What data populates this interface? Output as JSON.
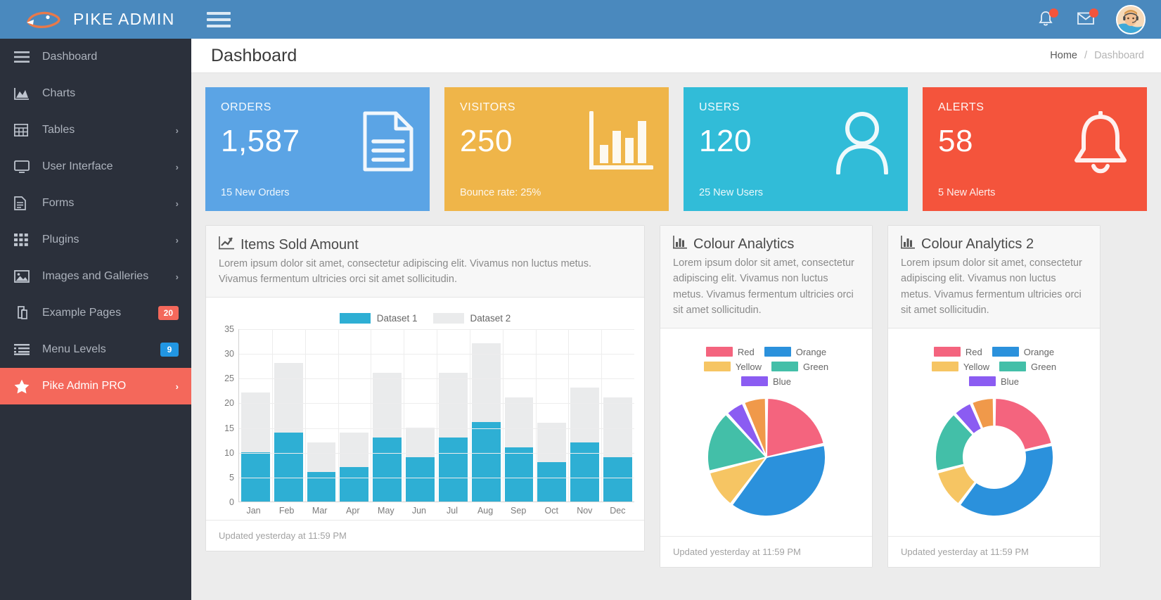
{
  "brand": {
    "title": "PIKE ADMIN",
    "logo_icon": "fish-logo-icon",
    "bg": "#4A89BE"
  },
  "sidebar": {
    "bg": "#2B303B",
    "active_color": "#F4685B",
    "items": [
      {
        "label": "Dashboard",
        "icon": "menu-bars-icon",
        "caret": "",
        "badge": "",
        "badge_type": "",
        "active": false
      },
      {
        "label": "Charts",
        "icon": "area-chart-icon",
        "caret": "",
        "badge": "",
        "badge_type": "",
        "active": false
      },
      {
        "label": "Tables",
        "icon": "table-grid-icon",
        "caret": "›",
        "badge": "",
        "badge_type": "",
        "active": false
      },
      {
        "label": "User Interface",
        "icon": "monitor-icon",
        "caret": "›",
        "badge": "",
        "badge_type": "",
        "active": false
      },
      {
        "label": "Forms",
        "icon": "document-lines-icon",
        "caret": "›",
        "badge": "",
        "badge_type": "",
        "active": false
      },
      {
        "label": "Plugins",
        "icon": "grid-dots-icon",
        "caret": "›",
        "badge": "",
        "badge_type": "",
        "active": false
      },
      {
        "label": "Images and Galleries",
        "icon": "image-picture-icon",
        "caret": "›",
        "badge": "",
        "badge_type": "",
        "active": false
      },
      {
        "label": "Example Pages",
        "icon": "copy-pages-icon",
        "caret": "",
        "badge": "20",
        "badge_type": "red",
        "active": false
      },
      {
        "label": "Menu Levels",
        "icon": "list-indent-icon",
        "caret": "",
        "badge": "9",
        "badge_type": "blue",
        "active": false
      },
      {
        "label": "Pike Admin PRO",
        "icon": "star-icon",
        "caret": "›",
        "badge": "",
        "badge_type": "",
        "active": true
      }
    ]
  },
  "topbar": {
    "menu_toggle_icon": "hamburger-icon",
    "notifications_icon": "bell-icon",
    "messages_icon": "envelope-icon",
    "avatar_icon": "user-avatar",
    "notification_badge": true,
    "message_badge": true
  },
  "page": {
    "title": "Dashboard",
    "breadcrumb": {
      "home": "Home",
      "separator": "/",
      "current": "Dashboard"
    }
  },
  "stats": [
    {
      "label": "ORDERS",
      "value": "1,587",
      "sub": "15 New Orders",
      "color": "#5BA4E5",
      "icon": "document-icon"
    },
    {
      "label": "VISITORS",
      "value": "250",
      "sub": "Bounce rate: 25%",
      "color": "#EFB549",
      "icon": "bar-chart-icon"
    },
    {
      "label": "USERS",
      "value": "120",
      "sub": "25 New Users",
      "color": "#31BCD8",
      "icon": "person-icon"
    },
    {
      "label": "ALERTS",
      "value": "58",
      "sub": "5 New Alerts",
      "color": "#F4543C",
      "icon": "bell-icon"
    }
  ],
  "panels": {
    "items_sold": {
      "icon": "line-chart-icon",
      "title": "Items Sold Amount",
      "desc": "Lorem ipsum dolor sit amet, consectetur adipiscing elit. Vivamus non luctus metus. Vivamus fermentum ultricies orci sit amet sollicitudin.",
      "footer": "Updated yesterday at 11:59 PM"
    },
    "colour_analytics": {
      "icon": "bar-chart-small-icon",
      "title": "Colour Analytics",
      "desc": "Lorem ipsum dolor sit amet, consectetur adipiscing elit. Vivamus non luctus metus. Vivamus fermentum ultricies orci sit amet sollicitudin.",
      "footer": "Updated yesterday at 11:59 PM"
    },
    "colour_analytics_2": {
      "icon": "bar-chart-small-icon",
      "title": "Colour Analytics 2",
      "desc": "Lorem ipsum dolor sit amet, consectetur adipiscing elit. Vivamus non luctus metus. Vivamus fermentum ultricies orci sit amet sollicitudin.",
      "footer": "Updated yesterday at 11:59 PM"
    }
  },
  "chart_data": [
    {
      "id": "items-sold-bar",
      "type": "bar",
      "stacked": true,
      "title": "Items Sold Amount",
      "xlabel": "",
      "ylabel": "",
      "ylim": [
        0,
        35
      ],
      "yticks": [
        0,
        5,
        10,
        15,
        20,
        25,
        30,
        35
      ],
      "grid": true,
      "legend_position": "top",
      "categories": [
        "Jan",
        "Feb",
        "Mar",
        "Apr",
        "May",
        "Jun",
        "Jul",
        "Aug",
        "Sep",
        "Oct",
        "Nov",
        "Dec"
      ],
      "series": [
        {
          "name": "Dataset 1",
          "color": "#2EAFD4",
          "values": [
            10,
            14,
            6,
            7,
            13,
            9,
            13,
            16,
            11,
            8,
            12,
            9
          ]
        },
        {
          "name": "Dataset 2",
          "color": "#EAEBEC",
          "values": [
            12,
            14,
            6,
            7,
            13,
            6,
            13,
            16,
            10,
            8,
            11,
            12
          ]
        }
      ],
      "stack_totals": [
        22,
        28,
        12,
        14,
        26,
        15,
        26,
        32,
        21,
        16,
        23,
        21
      ]
    },
    {
      "id": "colour-analytics-pie",
      "type": "pie",
      "title": "Colour Analytics",
      "legend_position": "top",
      "labels": [
        "Red",
        "Orange",
        "Yellow",
        "Green",
        "Blue"
      ],
      "colors": [
        "#F4647E",
        "#2B91DC",
        "#F6C563",
        "#43BFA8",
        "#8B5CF2"
      ],
      "legend_colors": [
        "#F4647E",
        "#2B91DC",
        "#F6C563",
        "#43BFA8",
        "#8B5CF2"
      ],
      "values": [
        20,
        36,
        10,
        16,
        5
      ],
      "slice_colors": [
        "#F4647E",
        "#2B91DC",
        "#F6C563",
        "#43BFA8",
        "#8B5CF2",
        "#F0994A"
      ],
      "slice_order": [
        "Red",
        "Blue-large",
        "Yellow",
        "Green",
        "Purple",
        "Orange"
      ]
    },
    {
      "id": "colour-analytics-doughnut",
      "type": "pie",
      "variant": "doughnut",
      "title": "Colour Analytics 2",
      "legend_position": "top",
      "labels": [
        "Red",
        "Orange",
        "Yellow",
        "Green",
        "Blue"
      ],
      "colors": [
        "#F4647E",
        "#2B91DC",
        "#F6C563",
        "#43BFA8",
        "#8B5CF2"
      ],
      "values": [
        20,
        36,
        10,
        16,
        5
      ],
      "cutout_percent": 52
    }
  ]
}
